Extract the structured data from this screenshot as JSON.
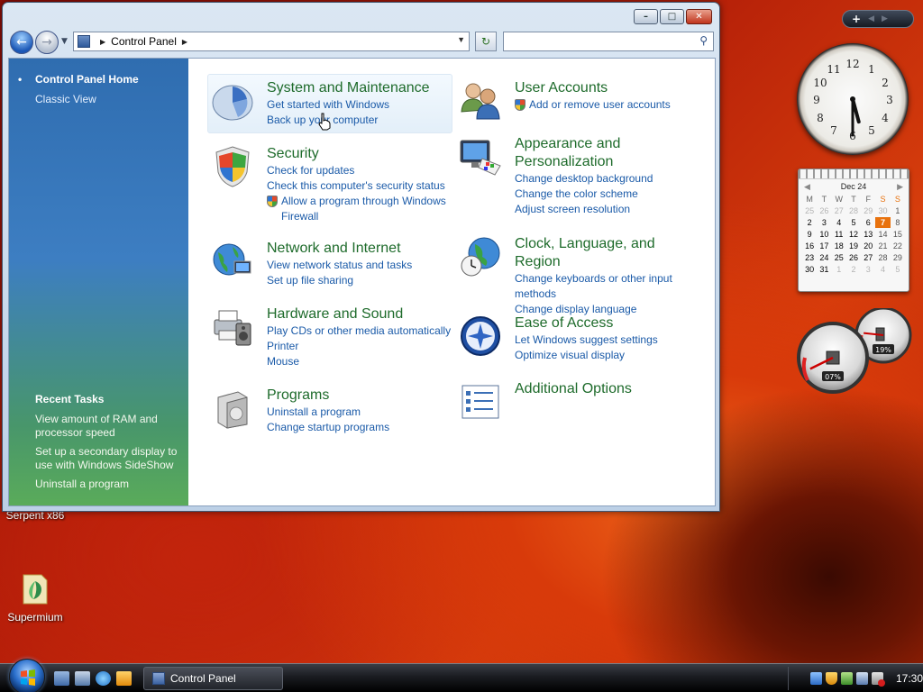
{
  "window": {
    "address": {
      "root_label": "Control Panel"
    },
    "search": {
      "placeholder": ""
    },
    "controls": {
      "minimize": "–",
      "maximize": "□",
      "close": "✕"
    }
  },
  "sidebar": {
    "home_label": "Control Panel Home",
    "classic_label": "Classic View",
    "recent_tasks_title": "Recent Tasks",
    "recent_tasks": [
      "View amount of RAM and processor speed",
      "Set up a secondary display to use with Windows SideShow",
      "Uninstall a program"
    ]
  },
  "categories": [
    {
      "title": "System and Maintenance",
      "links": [
        "Get started with Windows",
        "Back up your computer"
      ],
      "icon": "system-maintenance-icon"
    },
    {
      "title": "Security",
      "links": [
        "Check for updates",
        "Check this computer's security status",
        "Allow a program through Windows Firewall"
      ],
      "icon": "security-shield-icon"
    },
    {
      "title": "Network and Internet",
      "links": [
        "View network status and tasks",
        "Set up file sharing"
      ],
      "icon": "network-globe-icon"
    },
    {
      "title": "Hardware and Sound",
      "links": [
        "Play CDs or other media automatically",
        "Printer",
        "Mouse"
      ],
      "icon": "printer-speaker-icon"
    },
    {
      "title": "Programs",
      "links": [
        "Uninstall a program",
        "Change startup programs"
      ],
      "icon": "programs-box-icon"
    },
    {
      "title": "User Accounts",
      "links": [
        "Add or remove user accounts"
      ],
      "icon": "users-icon"
    },
    {
      "title": "Appearance and Personalization",
      "links": [
        "Change desktop background",
        "Change the color scheme",
        "Adjust screen resolution"
      ],
      "icon": "monitor-palette-icon"
    },
    {
      "title": "Clock, Language, and Region",
      "links": [
        "Change keyboards or other input methods",
        "Change display language"
      ],
      "icon": "globe-clock-icon"
    },
    {
      "title": "Ease of Access",
      "links": [
        "Let Windows suggest settings",
        "Optimize visual display"
      ],
      "icon": "ease-of-access-icon"
    },
    {
      "title": "Additional Options",
      "links": [],
      "icon": "checklist-icon"
    }
  ],
  "desktop_icons": [
    {
      "label": "Serpent x86"
    },
    {
      "label": "Supermium"
    }
  ],
  "gadgets": {
    "bar_plus": "+",
    "clock": {
      "hour": 5,
      "minute": 30
    },
    "calendar": {
      "title": "Dec 24",
      "weekday_headers": [
        "M",
        "T",
        "W",
        "T",
        "F",
        "S",
        "S"
      ],
      "days": [
        "25",
        "26",
        "27",
        "28",
        "29",
        "30",
        "1",
        "2",
        "3",
        "4",
        "5",
        "6",
        "7",
        "8",
        "9",
        "10",
        "11",
        "12",
        "13",
        "14",
        "15",
        "16",
        "17",
        "18",
        "19",
        "20",
        "21",
        "22",
        "23",
        "24",
        "25",
        "26",
        "27",
        "28",
        "29",
        "30",
        "31",
        "1",
        "2",
        "3",
        "4",
        "5"
      ],
      "today": "7"
    },
    "cpu_meter": {
      "cpu_label": "07%",
      "memory_label": "19%",
      "cpu_value": 0.07,
      "memory_value": 0.19
    }
  },
  "taskbar": {
    "task_label": "Control Panel",
    "time": "17:30"
  },
  "colors": {
    "title_green": "#1e6b2b",
    "link_blue": "#1a5aa8",
    "today_orange": "#e8720e"
  }
}
